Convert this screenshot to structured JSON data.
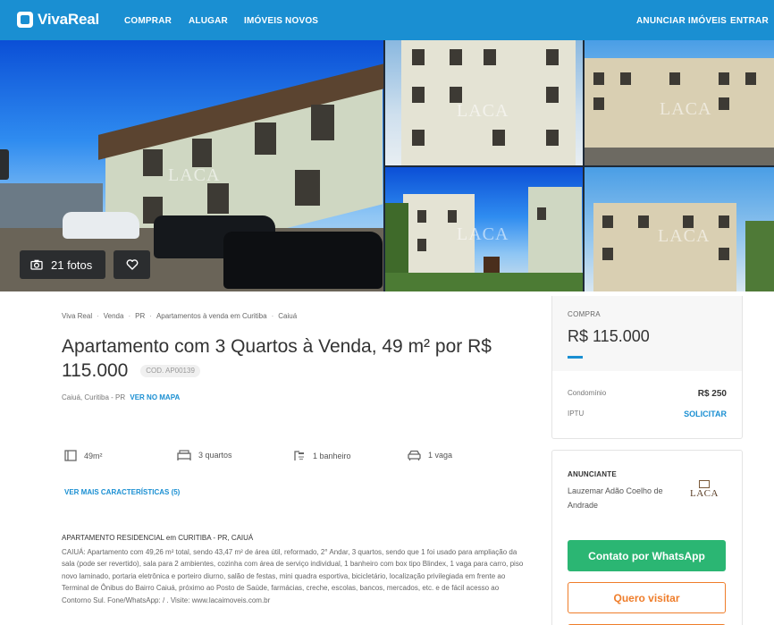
{
  "header": {
    "logo": "VivaReal",
    "nav_left": [
      "COMPRAR",
      "ALUGAR",
      "IMÓVEIS NOVOS"
    ],
    "nav_right": [
      "ANUNCIAR IMÓVEIS",
      "ENTRAR"
    ],
    "color": "#1a8fd2"
  },
  "gallery": {
    "photos_label": "21 fotos",
    "watermark": "LACA"
  },
  "breadcrumb": [
    "Viva Real",
    "Venda",
    "PR",
    "Apartamentos à venda em Curitiba",
    "Caiuá"
  ],
  "listing": {
    "title": "Apartamento com 3 Quartos à Venda, 49 m² por R$ 115.000",
    "code": "COD. AP00139",
    "location": "Caiuá, Curitiba - PR",
    "map_link": "VER NO MAPA",
    "features": [
      {
        "icon": "area-icon",
        "label": "49m²"
      },
      {
        "icon": "bed-icon",
        "label": "3 quartos"
      },
      {
        "icon": "shower-icon",
        "label": "1 banheiro"
      },
      {
        "icon": "car-icon",
        "label": "1 vaga"
      }
    ],
    "more_link": "VER MAIS CARACTERÍSTICAS (5)",
    "description_title": "APARTAMENTO RESIDENCIAL em CURITIBA - PR, CAIUÁ",
    "description": "CAIUÁ: Apartamento com 49,26 m² total, sendo 43,47 m² de área útil, reformado, 2° Andar, 3 quartos, sendo que 1 foi usado para ampliação da sala (pode ser revertido), sala para 2 ambientes, cozinha com área de serviço individual, 1 banheiro com box tipo Blindex, 1 vaga para carro, piso novo laminado, portaria eletrônica e porteiro diurno, salão de festas, mini quadra esportiva, bicicletário, localização privilegiada em frente ao Terminal de Ônibus do Bairro Caiuá, próximo ao Posto de Saúde, farmácias, creche, escolas, bancos, mercados, etc. e de fácil acesso ao Contorno Sul. Fone/WhatsApp: / . Visite: www.lacaimoveis.com.br"
  },
  "price_card": {
    "label": "COMPRA",
    "price": "R$ 115.000",
    "condo_label": "Condomínio",
    "condo_value": "R$ 250",
    "iptu_label": "IPTU",
    "iptu_link": "SOLICITAR"
  },
  "advertiser": {
    "label": "ANUNCIANTE",
    "name": "Lauzemar Adão Coelho de Andrade",
    "logo_text": "LACA",
    "whatsapp_button": "Contato por WhatsApp",
    "visit_button": "Quero visitar",
    "whatsapp_color": "#2bb673",
    "visit_color": "#ef7d2a"
  }
}
